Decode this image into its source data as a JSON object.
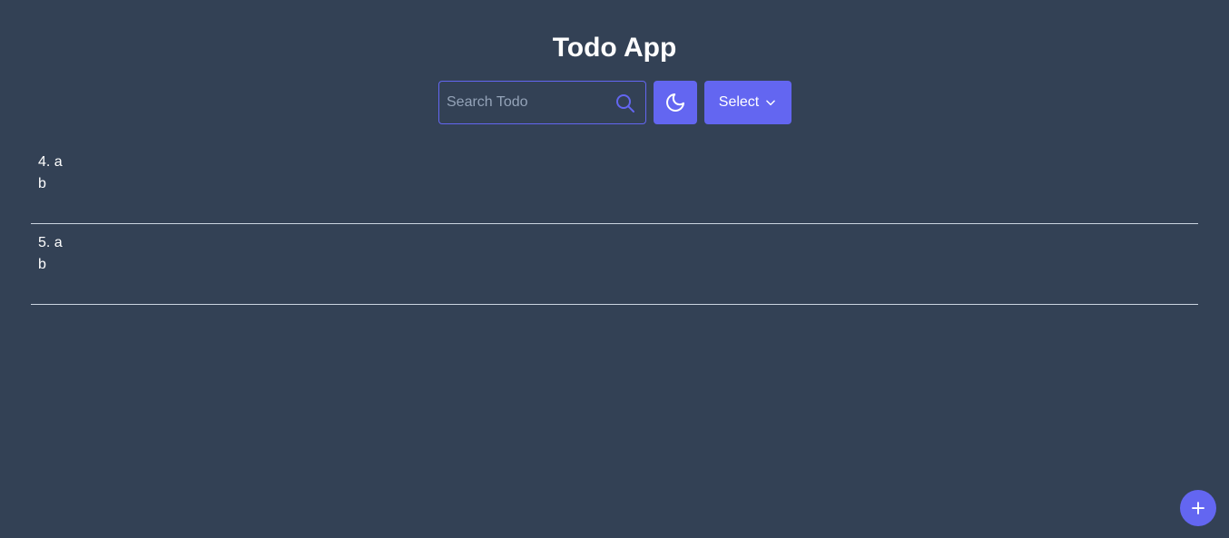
{
  "header": {
    "title": "Todo App"
  },
  "toolbar": {
    "search_placeholder": "Search Todo",
    "search_value": "",
    "search_icon": "search-icon",
    "theme_icon": "moon-icon",
    "select_label": "Select",
    "select_icon": "chevron-down-icon"
  },
  "todos": [
    {
      "number": "4.",
      "title": "a",
      "description": "b"
    },
    {
      "number": "5.",
      "title": "a",
      "description": "b"
    }
  ],
  "fab": {
    "icon": "plus-icon"
  },
  "colors": {
    "background": "#334155",
    "accent": "#6366f1",
    "text": "#ffffff",
    "placeholder": "#94a3b8",
    "divider": "#cbd5e1"
  }
}
